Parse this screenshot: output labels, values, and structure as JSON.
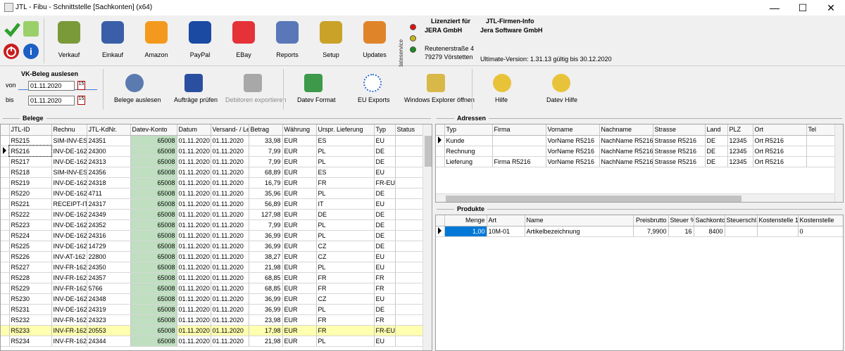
{
  "window": {
    "title": "JTL - Fibu - Schnittstelle [Sachkonten] (x64)",
    "min": "—",
    "max": "☐",
    "close": "✕"
  },
  "toolbar": {
    "items": [
      {
        "label": "Verkauf",
        "icon": "shopping-basket-icon",
        "color": "#7a9a3a"
      },
      {
        "label": "Einkauf",
        "icon": "grid-icon",
        "color": "#3a5fa8"
      },
      {
        "label": "Amazon",
        "icon": "amazon-icon",
        "color": "#f39a1e"
      },
      {
        "label": "PayPal",
        "icon": "paypal-icon",
        "color": "#1b4aa3"
      },
      {
        "label": "EBay",
        "icon": "ebay-icon",
        "color": "#e53238"
      },
      {
        "label": "Reports",
        "icon": "magnifier-icon",
        "color": "#5a78b8"
      },
      {
        "label": "Setup",
        "icon": "setup-icon",
        "color": "#c9a227"
      },
      {
        "label": "Updates",
        "icon": "updates-icon",
        "color": "#e0842a"
      }
    ],
    "updateservice": "Updateservice",
    "license": {
      "label": "Lizenziert für",
      "company": "JERA GmbH",
      "info_label": "JTL-Firmen-Info",
      "info_company": "Jera Software GmbH",
      "street": "Reutenerstraße 4",
      "city": "79279 Vörstetten",
      "version": "Ultimate-Version: 1.31.13 gültig bis 30.12.2020"
    }
  },
  "vk": {
    "title": "VK-Beleg auslesen",
    "von_label": "von",
    "bis_label": "bis",
    "von": "01.11.2020",
    "bis": "01.11.2020",
    "cal": "15"
  },
  "toolbar2": {
    "belege_auslesen": "Belege auslesen",
    "auftraege_pruefen": "Aufträge prüfen",
    "debitoren_exportieren": "Debitoren exportieren",
    "datev_format": "Datev Format",
    "eu_exports": "EU Exports",
    "explorer": "Windows Explorer öffnen",
    "hilfe": "Hilfe",
    "datev_hilfe": "Datev Hilfe"
  },
  "belege": {
    "title": "Belege",
    "columns": [
      "JTL-ID",
      "Rechnu",
      "JTL-KdNr.",
      "Datev-Konto",
      "Datum",
      "Versand- / Leist",
      "Betrag",
      "Währung",
      "Urspr. Lieferung",
      "Typ",
      "Status"
    ],
    "rows": [
      [
        "R5215",
        "SIM-INV-ES",
        "24351",
        "65008",
        "01.11.2020",
        "01.11.2020",
        "33,98",
        "EUR",
        "ES",
        "EU",
        ""
      ],
      [
        "R5216",
        "INV-DE-162",
        "24300",
        "65008",
        "01.11.2020",
        "01.11.2020",
        "7,99",
        "EUR",
        "PL",
        "DE",
        ""
      ],
      [
        "R5217",
        "INV-DE-162",
        "24313",
        "65008",
        "01.11.2020",
        "01.11.2020",
        "7,99",
        "EUR",
        "PL",
        "DE",
        ""
      ],
      [
        "R5218",
        "SIM-INV-ES",
        "24356",
        "65008",
        "01.11.2020",
        "01.11.2020",
        "68,89",
        "EUR",
        "ES",
        "EU",
        ""
      ],
      [
        "R5219",
        "INV-DE-162",
        "24318",
        "65008",
        "01.11.2020",
        "01.11.2020",
        "16,79",
        "EUR",
        "FR",
        "FR-EU",
        ""
      ],
      [
        "R5220",
        "INV-DE-162",
        "4711",
        "65008",
        "01.11.2020",
        "01.11.2020",
        "35,96",
        "EUR",
        "PL",
        "DE",
        ""
      ],
      [
        "R5221",
        "RECEIPT-IT",
        "24317",
        "65008",
        "01.11.2020",
        "01.11.2020",
        "56,89",
        "EUR",
        "IT",
        "EU",
        ""
      ],
      [
        "R5222",
        "INV-DE-162",
        "24349",
        "65008",
        "01.11.2020",
        "01.11.2020",
        "127,98",
        "EUR",
        "DE",
        "DE",
        ""
      ],
      [
        "R5223",
        "INV-DE-162",
        "24352",
        "65008",
        "01.11.2020",
        "01.11.2020",
        "7,99",
        "EUR",
        "PL",
        "DE",
        ""
      ],
      [
        "R5224",
        "INV-DE-162",
        "24316",
        "65008",
        "01.11.2020",
        "01.11.2020",
        "36,99",
        "EUR",
        "PL",
        "DE",
        ""
      ],
      [
        "R5225",
        "INV-DE-162",
        "14729",
        "65008",
        "01.11.2020",
        "01.11.2020",
        "36,99",
        "EUR",
        "CZ",
        "DE",
        ""
      ],
      [
        "R5226",
        "INV-AT-162",
        "22800",
        "65008",
        "01.11.2020",
        "01.11.2020",
        "38,27",
        "EUR",
        "CZ",
        "EU",
        ""
      ],
      [
        "R5227",
        "INV-FR-162",
        "24350",
        "65008",
        "01.11.2020",
        "01.11.2020",
        "21,98",
        "EUR",
        "PL",
        "EU",
        ""
      ],
      [
        "R5228",
        "INV-FR-162",
        "24357",
        "65008",
        "01.11.2020",
        "01.11.2020",
        "68,85",
        "EUR",
        "FR",
        "FR",
        ""
      ],
      [
        "R5229",
        "INV-FR-162",
        "5766",
        "65008",
        "01.11.2020",
        "01.11.2020",
        "68,85",
        "EUR",
        "FR",
        "FR",
        ""
      ],
      [
        "R5230",
        "INV-DE-162",
        "24348",
        "65008",
        "01.11.2020",
        "01.11.2020",
        "36,99",
        "EUR",
        "CZ",
        "EU",
        ""
      ],
      [
        "R5231",
        "INV-DE-162",
        "24319",
        "65008",
        "01.11.2020",
        "01.11.2020",
        "36,99",
        "EUR",
        "PL",
        "DE",
        ""
      ],
      [
        "R5232",
        "INV-FR-162",
        "24323",
        "65008",
        "01.11.2020",
        "01.11.2020",
        "23,98",
        "EUR",
        "FR",
        "FR",
        ""
      ],
      [
        "R5233",
        "INV-FR-162",
        "20553",
        "65008",
        "01.11.2020",
        "01.11.2020",
        "17,98",
        "EUR",
        "FR",
        "FR-EU",
        ""
      ],
      [
        "R5234",
        "INV-FR-162",
        "24344",
        "65008",
        "01.11.2020",
        "01.11.2020",
        "21,98",
        "EUR",
        "PL",
        "EU",
        ""
      ]
    ],
    "selected_row": 1,
    "highlight_row": 18
  },
  "adressen": {
    "title": "Adressen",
    "columns": [
      "Typ",
      "Firma",
      "Vorname",
      "Nachname",
      "Strasse",
      "Land",
      "PLZ",
      "Ort",
      "Tel"
    ],
    "rows": [
      [
        "Kunde",
        "",
        "VorName R5216",
        "NachName  R5216",
        "Strasse  R5216",
        "DE",
        "12345",
        "Ort  R5216",
        ""
      ],
      [
        "Rechnung",
        "",
        "VorName R5216",
        "NachName  R5216",
        "Strasse  R5216",
        "DE",
        "12345",
        "Ort  R5216",
        ""
      ],
      [
        "Lieferung",
        "Firma R5216",
        "VorName R5216",
        "NachName  R5216",
        "Strasse  R5216",
        "DE",
        "12345",
        "Ort  R5216",
        ""
      ]
    ]
  },
  "produkte": {
    "title": "Produkte",
    "columns": [
      "Menge",
      "Art",
      "Name",
      "Preisbrutto",
      "Steuer %",
      "Sachkonto",
      "Steuerschl.",
      "Kostenstelle 1",
      "Kostenstelle"
    ],
    "rows": [
      [
        "1,00",
        "10M-01",
        "Artikelbezeichnung",
        "7,9900",
        "16",
        "8400",
        "",
        "",
        "0"
      ]
    ]
  }
}
